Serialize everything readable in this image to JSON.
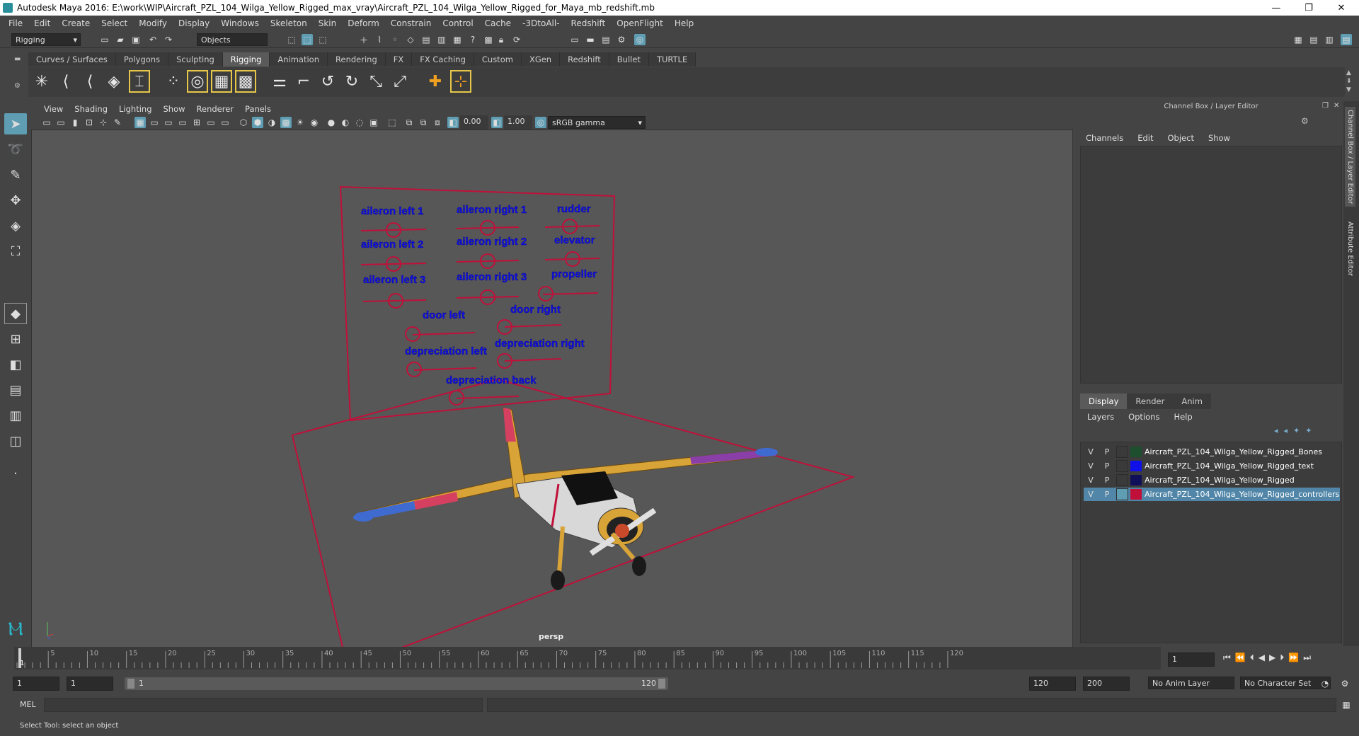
{
  "titlebar": {
    "title": "Autodesk Maya 2016: E:\\work\\WIP\\Aircraft_PZL_104_Wilga_Yellow_Rigged_max_vray\\Aircraft_PZL_104_Wilga_Yellow_Rigged_for_Maya_mb_redshift.mb",
    "minimize": "—",
    "restore": "❐",
    "close": "✕"
  },
  "menubar": {
    "items": [
      "File",
      "Edit",
      "Create",
      "Select",
      "Modify",
      "Display",
      "Windows",
      "Skeleton",
      "Skin",
      "Deform",
      "Constrain",
      "Control",
      "Cache",
      "-3DtoAll-",
      "Redshift",
      "OpenFlight",
      "Help"
    ]
  },
  "statusline": {
    "menuset": "Rigging",
    "selection_mode": "Objects"
  },
  "shelf": {
    "tabs": [
      "Curves / Surfaces",
      "Polygons",
      "Sculpting",
      "Rigging",
      "Animation",
      "Rendering",
      "FX",
      "FX Caching",
      "Custom",
      "XGen",
      "Redshift",
      "Bullet",
      "TURTLE"
    ],
    "active_tab": "Rigging"
  },
  "viewport": {
    "menu": [
      "View",
      "Shading",
      "Lighting",
      "Show",
      "Renderer",
      "Panels"
    ],
    "exposure": "0.00",
    "gamma": "1.00",
    "color_space": "sRGB gamma",
    "camera_label": "persp",
    "controller_labels": [
      "aileron left 1",
      "aileron right 1",
      "rudder",
      "aileron left 2",
      "aileron right 2",
      "elevator",
      "aileron left 3",
      "aileron right 3",
      "propeller",
      "door left",
      "door right",
      "depreciation left",
      "depreciation right",
      "depreciation back"
    ]
  },
  "channel_box": {
    "title": "Channel Box / Layer Editor",
    "menu": [
      "Channels",
      "Edit",
      "Object",
      "Show"
    ]
  },
  "layer_editor": {
    "tabs": [
      "Display",
      "Render",
      "Anim"
    ],
    "active_tab": "Display",
    "menu": [
      "Layers",
      "Options",
      "Help"
    ],
    "layers": [
      {
        "v": "V",
        "p": "P",
        "name": "Aircraft_PZL_104_Wilga_Yellow_Rigged_Bones",
        "color": "#1d4f2e",
        "selected": false
      },
      {
        "v": "V",
        "p": "P",
        "name": "Aircraft_PZL_104_Wilga_Yellow_Rigged_text",
        "color": "#1010e8",
        "selected": false
      },
      {
        "v": "V",
        "p": "P",
        "name": "Aircraft_PZL_104_Wilga_Yellow_Rigged",
        "color": "#10105a",
        "selected": false
      },
      {
        "v": "V",
        "p": "P",
        "name": "Aircraft_PZL_104_Wilga_Yellow_Rigged_controllers",
        "color": "#c0103a",
        "selected": true
      }
    ]
  },
  "side_tabs": [
    "Channel Box / Layer Editor",
    "Attribute Editor"
  ],
  "timeslider": {
    "ticks": [
      "5",
      "10",
      "15",
      "20",
      "25",
      "30",
      "35",
      "40",
      "45",
      "50",
      "55",
      "60",
      "65",
      "70",
      "75",
      "80",
      "85",
      "90",
      "95",
      "100",
      "105",
      "110",
      "115",
      "120"
    ],
    "current_frame_marker": "1",
    "current_frame_field": "1"
  },
  "range": {
    "start": "1",
    "playback_start": "1",
    "slider_start": "1",
    "slider_end": "120",
    "playback_end": "120",
    "end": "200",
    "anim_layer": "No Anim Layer",
    "character_set": "No Character Set"
  },
  "cmdline": {
    "label": "MEL"
  },
  "helpline": {
    "text": "Select Tool: select an object"
  }
}
